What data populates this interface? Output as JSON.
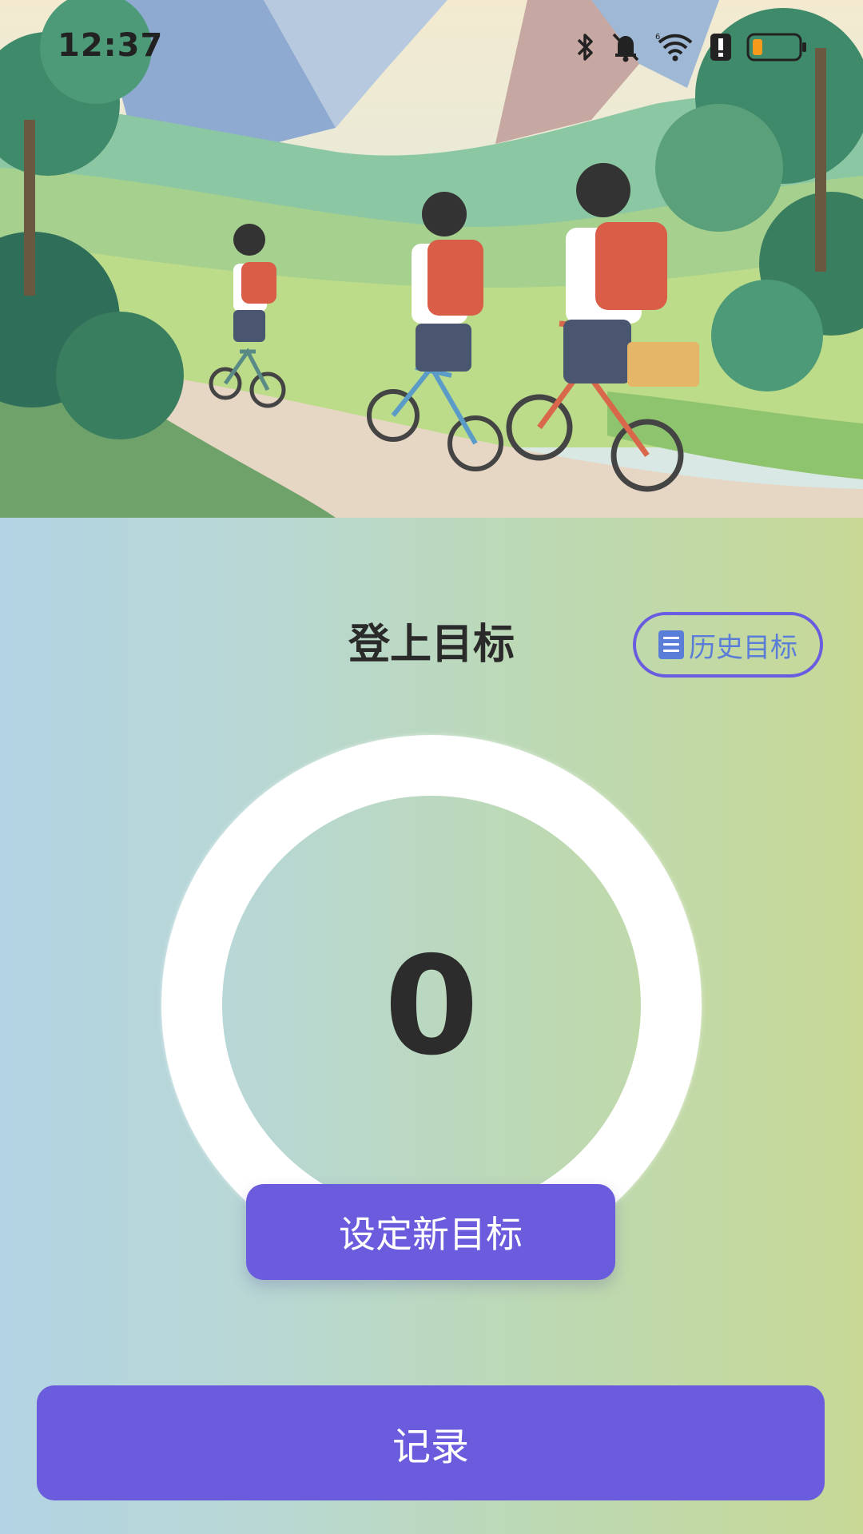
{
  "status_bar": {
    "time": "12:37",
    "icons": [
      "bluetooth-icon",
      "bell-muted-icon",
      "wifi-icon",
      "alert-icon",
      "battery-low-icon"
    ]
  },
  "hero": {
    "image": "illustration of three children cycling on a mountain path"
  },
  "header": {
    "title": "登上目标",
    "history_label": "历史目标",
    "history_icon": "document-list-icon"
  },
  "progress": {
    "value": "0"
  },
  "actions": {
    "set_goal_label": "设定新目标",
    "record_label": "记录"
  },
  "colors": {
    "accent": "#6a5cdc",
    "history_text": "#5a7ed8",
    "battery_low": "#f59a1b"
  }
}
